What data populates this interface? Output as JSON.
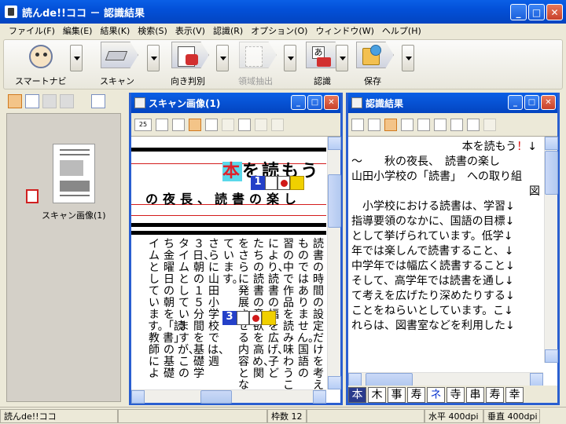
{
  "window": {
    "title": "読んde!!ココ － 認識結果"
  },
  "menu": [
    "ファイル(F)",
    "編集(E)",
    "結果(K)",
    "検索(S)",
    "表示(V)",
    "認識(R)",
    "オプション(O)",
    "ウィンドウ(W)",
    "ヘルプ(H)"
  ],
  "toolbar": {
    "smart_navi": "スマートナビ",
    "scan": "スキャン",
    "orientation": "向き判別",
    "region": "領域抽出",
    "recognize": "認識",
    "save": "保存"
  },
  "left_panel": {
    "thumb_label": "スキャン画像(1)"
  },
  "image_window": {
    "title": "スキャン画像(1)",
    "zoom_label": "25",
    "heading_hon": "本",
    "heading_rest": "を読もう",
    "subheading": "の夜長、読書の楽し",
    "mark1": "1",
    "mark3": "3",
    "columns": [
      "読書の時間の設定だけを考え",
      "ものではありません。国語の",
      "習の中で作品を読み味わうこ",
      "により、読書の幅を広げ、子ど",
      "たちの読書の意欲を高め、関",
      "をさらに発展させる内容とな",
      "ています。",
      "さらに山田小学校では、週",
      "３日、朝の１５分間を基礎学",
      "タイムとしていますが、この",
      "ち金曜日の朝を「読書」の基礎",
      "イムとしています。教師によ"
    ]
  },
  "result_window": {
    "title": "認識結果",
    "lines": [
      {
        "text": "本を読もう",
        "ex": "！",
        "end": "↓"
      },
      {
        "text": "〜　　秋の夜長、　読書の楽し"
      },
      {
        "text": "山田小学校の「読書」　への取り組"
      },
      {
        "text": "図"
      },
      {
        "text": ""
      },
      {
        "text": "　小学校における読書は、学習↓"
      },
      {
        "text": "指導要領のなかに、国語の目標↓"
      },
      {
        "text": "として挙げられています。低学↓"
      },
      {
        "text": "年では楽しんで読書すること、↓"
      },
      {
        "text": "中学年では幅広く読書すること↓"
      },
      {
        "text": "そして、高学年では読書を通し↓"
      },
      {
        "text": "て考えを広げたり深めたりする↓"
      },
      {
        "text": "ことをねらいとしています。こ↓"
      },
      {
        "text": "れらは、図書室などを利用した↓"
      }
    ],
    "candidates": [
      "本",
      "木",
      "事",
      "寿",
      "ネ",
      "寺",
      "串",
      "寿",
      "幸"
    ]
  },
  "status": {
    "app": "読んde!!ココ",
    "frames": "枠数 12",
    "horizontal_dpi": "水平 400dpi",
    "vertical_dpi": "垂直 400dpi"
  }
}
